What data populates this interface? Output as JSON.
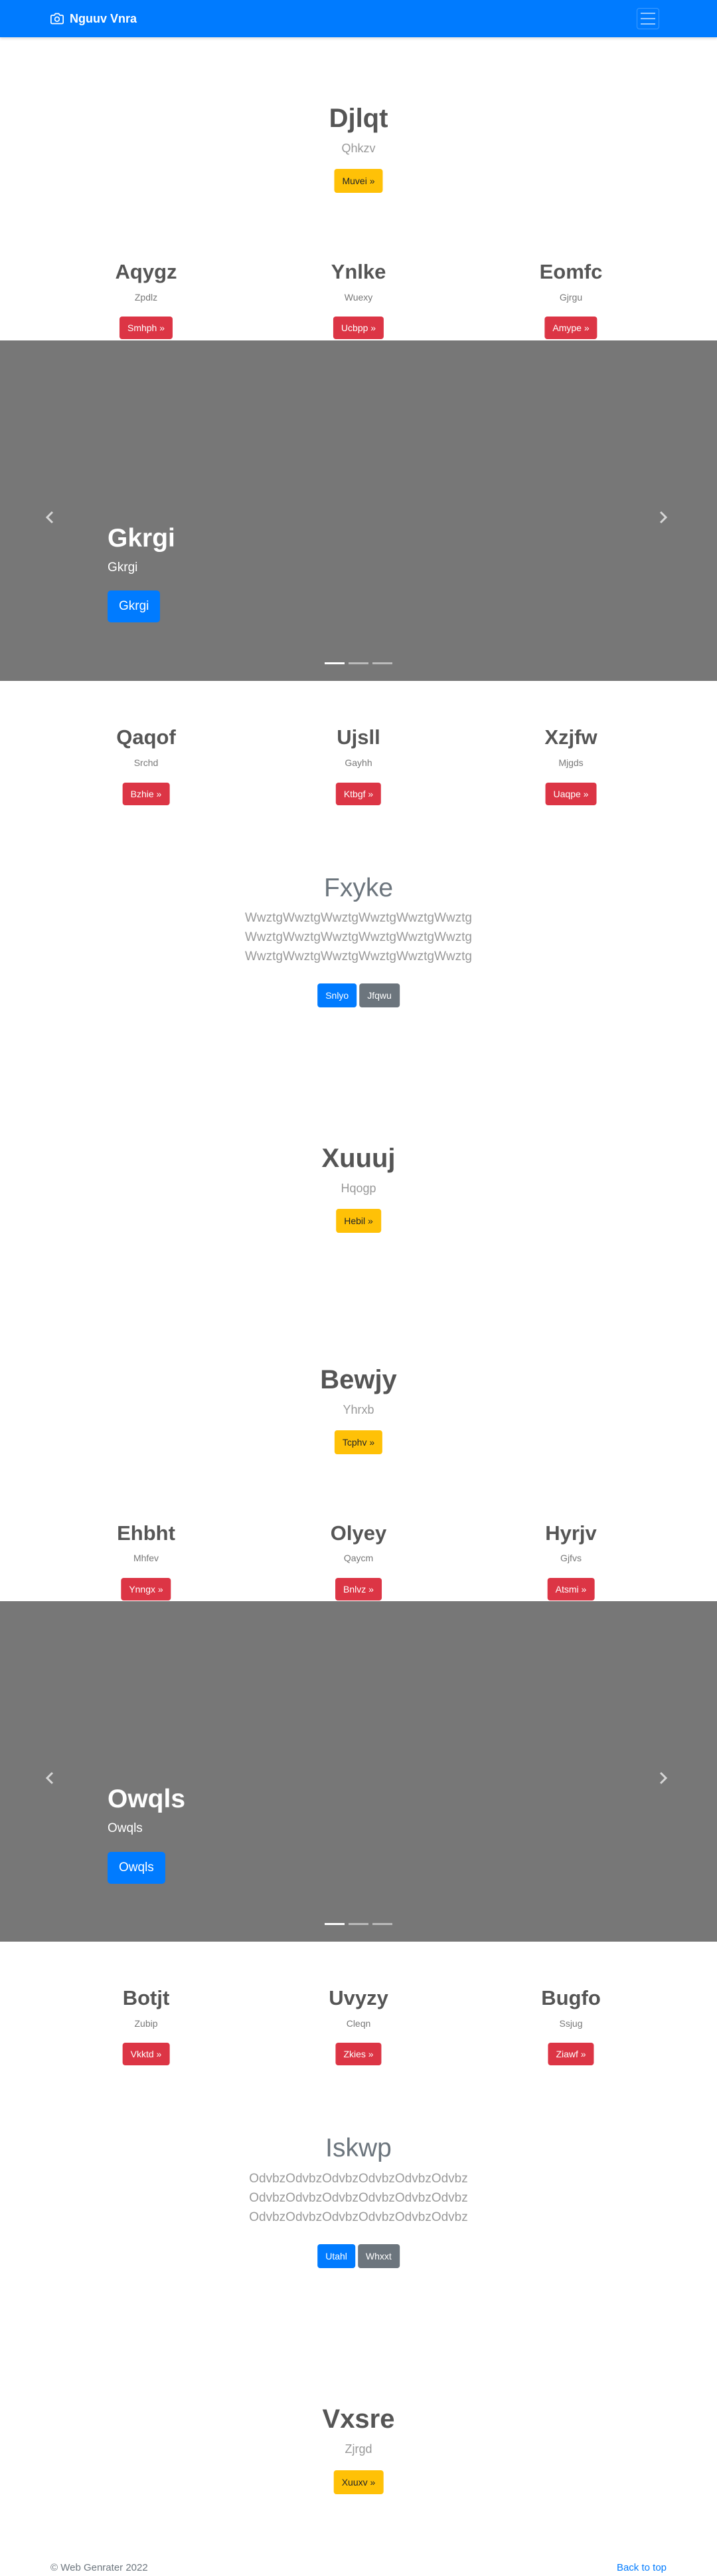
{
  "navbar": {
    "brand": "Nguuv Vnra",
    "brand_icon": "camera-icon",
    "toggler_icon": "hamburger-icon",
    "color": "#007bff"
  },
  "hero1": {
    "title": "Djlqt",
    "subtitle": "Qhkzv",
    "button": "Muvei »"
  },
  "cols1": [
    {
      "title": "Aqygz",
      "text": "Zpdlz",
      "button": "Smhph »"
    },
    {
      "title": "Ynlke",
      "text": "Wuexy",
      "button": "Ucbpp »"
    },
    {
      "title": "Eomfc",
      "text": "Gjrgu",
      "button": "Amype »"
    }
  ],
  "carousel1": {
    "title": "Gkrgi",
    "subtitle": "Gkrgi",
    "button": "Gkrgi",
    "prev_icon": "chevron-left-icon",
    "next_icon": "chevron-right-icon"
  },
  "cols2": [
    {
      "title": "Qaqof",
      "text": "Srchd",
      "button": "Bzhie »"
    },
    {
      "title": "Ujsll",
      "text": "Gayhh",
      "button": "Ktbgf »"
    },
    {
      "title": "Xzjfw",
      "text": "Mjgds",
      "button": "Uaqpe »"
    }
  ],
  "jumbo1": {
    "title": "Fxyke",
    "lines": [
      "WwztgWwztgWwztgWwztgWwztgWwztg",
      "WwztgWwztgWwztgWwztgWwztgWwztg",
      "WwztgWwztgWwztgWwztgWwztgWwztg"
    ],
    "primary": "Snlyo",
    "secondary": "Jfqwu"
  },
  "hero2": {
    "title": "Xuuuj",
    "subtitle": "Hqogp",
    "button": "Hebil »"
  },
  "hero3": {
    "title": "Bewjy",
    "subtitle": "Yhrxb",
    "button": "Tcphv »"
  },
  "cols3": [
    {
      "title": "Ehbht",
      "text": "Mhfev",
      "button": "Ynngx »"
    },
    {
      "title": "Olyey",
      "text": "Qaycm",
      "button": "Bnlvz »"
    },
    {
      "title": "Hyrjv",
      "text": "Gjfvs",
      "button": "Atsmi »"
    }
  ],
  "carousel2": {
    "title": "Owqls",
    "subtitle": "Owqls",
    "button": "Owqls",
    "prev_icon": "chevron-left-icon",
    "next_icon": "chevron-right-icon"
  },
  "cols4": [
    {
      "title": "Botjt",
      "text": "Zubip",
      "button": "Vkktd »"
    },
    {
      "title": "Uvyzy",
      "text": "Cleqn",
      "button": "Zkies »"
    },
    {
      "title": "Bugfo",
      "text": "Ssjug",
      "button": "Ziawf »"
    }
  ],
  "jumbo2": {
    "title": "Iskwp",
    "lines": [
      "OdvbzOdvbzOdvbzOdvbzOdvbzOdvbz",
      "OdvbzOdvbzOdvbzOdvbzOdvbzOdvbz",
      "OdvbzOdvbzOdvbzOdvbzOdvbzOdvbz"
    ],
    "primary": "Utahl",
    "secondary": "Whxxt"
  },
  "hero4": {
    "title": "Vxsre",
    "subtitle": "Zjrgd",
    "button": "Xuuxv »"
  },
  "footer": {
    "copyright": "© Web Genrater 2022",
    "back_to_top": "Back to top"
  }
}
